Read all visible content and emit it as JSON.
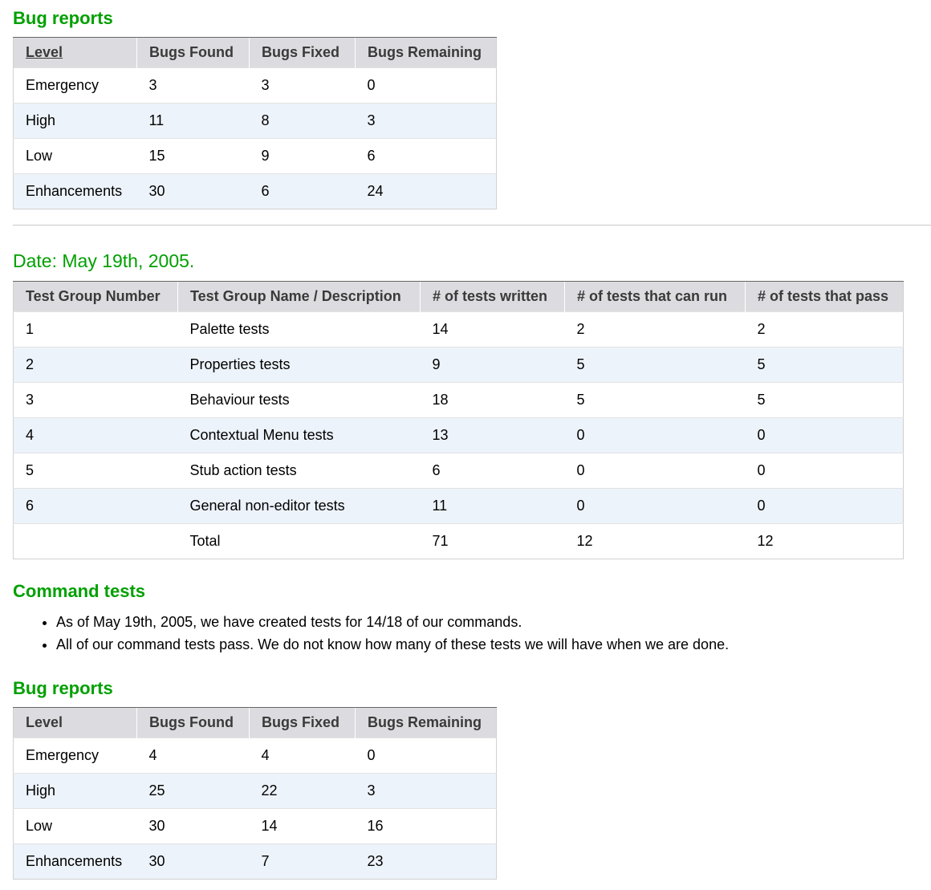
{
  "bug_reports_1": {
    "title": "Bug reports",
    "headers": [
      "Level",
      "Bugs Found",
      "Bugs Fixed",
      "Bugs Remaining"
    ],
    "rows": [
      [
        "Emergency",
        "3",
        "3",
        "0"
      ],
      [
        "High",
        "11",
        "8",
        "3"
      ],
      [
        "Low",
        "15",
        "9",
        "6"
      ],
      [
        "Enhancements",
        "30",
        "6",
        "24"
      ]
    ]
  },
  "date_section": {
    "title": "Date: May 19th, 2005.",
    "headers": [
      "Test Group Number",
      "Test Group Name / Description",
      "# of tests written",
      "# of tests that can run",
      "# of tests that pass"
    ],
    "rows": [
      [
        "1",
        "Palette tests",
        "14",
        "2",
        "2"
      ],
      [
        "2",
        "Properties tests",
        "9",
        "5",
        "5"
      ],
      [
        "3",
        "Behaviour tests",
        "18",
        "5",
        "5"
      ],
      [
        "4",
        "Contextual Menu tests",
        "13",
        "0",
        "0"
      ],
      [
        "5",
        "Stub action tests",
        "6",
        "0",
        "0"
      ],
      [
        "6",
        "General non-editor tests",
        "11",
        "0",
        "0"
      ],
      [
        "",
        "Total",
        "71",
        "12",
        "12"
      ]
    ]
  },
  "command_tests": {
    "title": "Command tests",
    "items": [
      "As of May 19th, 2005, we have created tests for 14/18 of our commands.",
      "All of our command tests pass. We do not know how many of these tests we will have when we are done."
    ]
  },
  "bug_reports_2": {
    "title": "Bug reports",
    "headers": [
      "Level",
      "Bugs Found",
      "Bugs Fixed",
      "Bugs Remaining"
    ],
    "rows": [
      [
        "Emergency",
        "4",
        "4",
        "0"
      ],
      [
        "High",
        "25",
        "22",
        "3"
      ],
      [
        "Low",
        "30",
        "14",
        "16"
      ],
      [
        "Enhancements",
        "30",
        "7",
        "23"
      ]
    ]
  },
  "colors": {
    "heading": "#00a000",
    "header_bg": "#dcdce0",
    "alt_row_bg": "#edf3fa"
  }
}
